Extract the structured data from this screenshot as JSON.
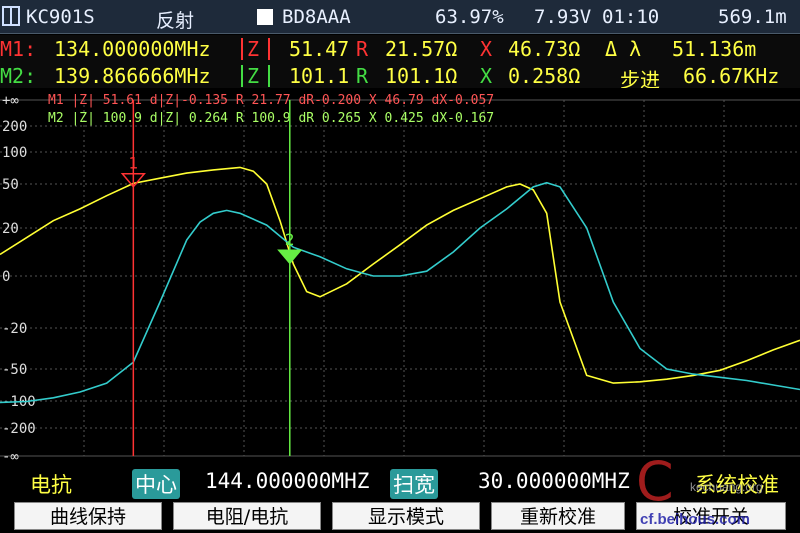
{
  "titlebar": {
    "model": "KC901S",
    "mode": "反射",
    "callsign": "BD8AAA",
    "battery": "63.97%",
    "voltage": "7.93V",
    "time": "01:10",
    "extra": "569.1m"
  },
  "markers": [
    {
      "label": "M1:",
      "freq": "134.000000MHz",
      "z": "Z",
      "r_val": "51.47",
      "r_tag": "R",
      "r": "21.57Ω",
      "x_tag": "X",
      "x": "46.73Ω",
      "extra_tag": "Δ λ",
      "extra": "51.136m",
      "color": "#ff3333"
    },
    {
      "label": "M2:",
      "freq": "139.866666MHz",
      "z": "Z",
      "r_val": "101.1",
      "r_tag": "R",
      "r": "101.1Ω",
      "x_tag": "X",
      "x": "0.258Ω",
      "extra_tag": "步进",
      "extra": "66.67KHz",
      "color": "#44dd44"
    }
  ],
  "readouts": [
    "M1 |Z| 51.61  d|Z|-0.135 R 21.77 dR-0.200 X 46.79  dX-0.057",
    "M2 |Z| 100.9  d|Z| 0.264 R 100.9 dR 0.265 X 0.425  dX-0.167"
  ],
  "yaxis_ticks": [
    "+∞",
    "200",
    "100",
    "50",
    "20",
    "0",
    "-20",
    "-50",
    "-100",
    "-200",
    "-∞"
  ],
  "marker_tags": [
    "1",
    "2"
  ],
  "bottom": {
    "mode": "电抗",
    "center_label": "中心",
    "center_value": "144.000000MHZ",
    "span_label": "扫宽",
    "span_value": "30.000000MHZ",
    "status": "系统校准"
  },
  "softkeys": [
    "曲线保持",
    "电阻/电抗",
    "显示模式",
    "重新校准",
    "校准开关"
  ],
  "watermark": {
    "top": "kechuang.org",
    "bottom": "cf.beihous.com"
  },
  "colors": {
    "yellow": "#ffff33",
    "cyan": "#33cccc",
    "m1": "#ff3333",
    "m2": "#66ee44",
    "grid": "#555555"
  },
  "chart_data": {
    "type": "line",
    "xlabel": "",
    "ylabel": "",
    "x_range_mhz": [
      129,
      159
    ],
    "series": [
      {
        "name": "M1",
        "color": "#ffff33",
        "x": [
          129,
          130,
          131,
          132,
          133,
          134,
          135,
          136,
          137,
          138,
          138.5,
          139,
          139.5,
          140,
          140.5,
          141,
          142,
          143,
          144,
          145,
          146,
          147,
          148,
          148.5,
          149,
          149.5,
          150,
          151,
          152,
          153,
          154,
          155,
          156,
          157,
          158,
          159
        ],
        "y": [
          9,
          16,
          25,
          33,
          42,
          51,
          59,
          67,
          72,
          76,
          70,
          50,
          25,
          5,
          -6,
          -8,
          -3,
          5,
          13,
          22,
          32,
          40,
          48,
          50,
          46,
          30,
          -10,
          -60,
          -72,
          -70,
          -66,
          -60,
          -52,
          -44,
          -36,
          -29
        ]
      },
      {
        "name": "M2",
        "color": "#33cccc",
        "x": [
          129,
          130,
          131,
          132,
          133,
          134,
          135,
          136,
          136.5,
          137,
          137.5,
          138,
          139,
          140,
          141,
          142,
          143,
          144,
          145,
          146,
          147,
          148,
          149,
          149.5,
          150,
          151,
          152,
          153,
          154,
          155,
          156,
          157,
          158,
          159
        ],
        "y": [
          -105,
          -102,
          -95,
          -86,
          -72,
          -45,
          -10,
          15,
          24,
          30,
          32,
          30,
          22,
          12,
          8,
          3,
          0,
          0,
          2,
          10,
          20,
          33,
          48,
          52,
          48,
          20,
          -10,
          -35,
          -50,
          -58,
          -63,
          -68,
          -75,
          -82
        ]
      }
    ]
  }
}
